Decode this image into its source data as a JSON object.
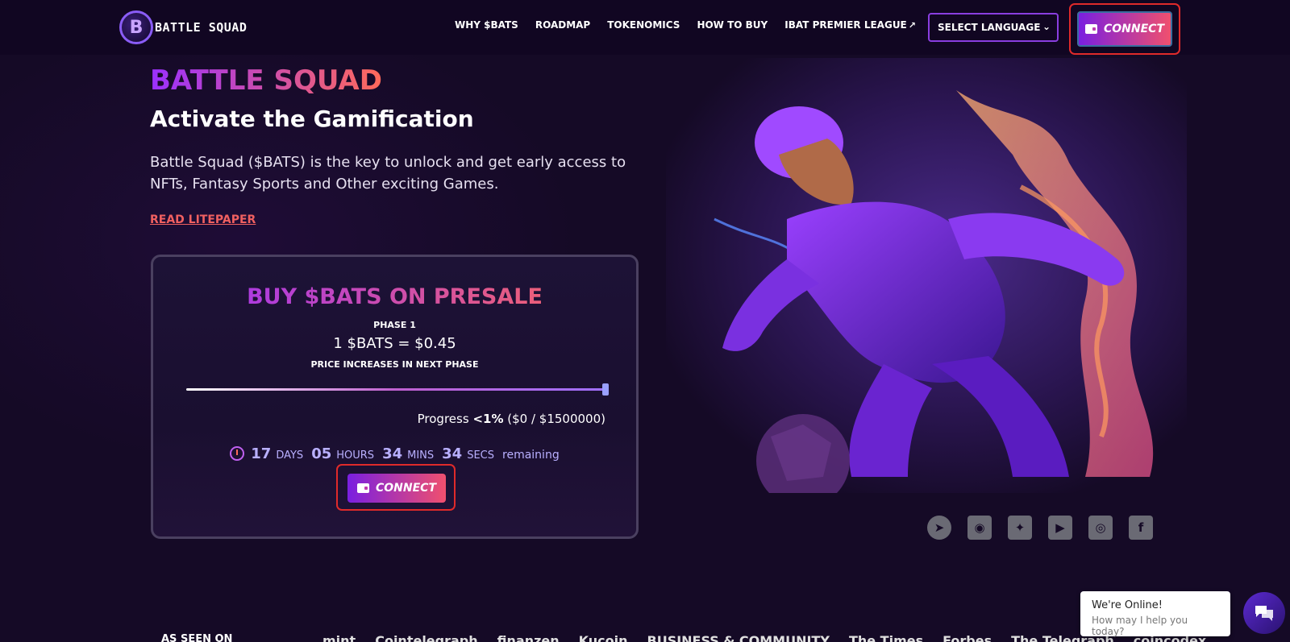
{
  "brand": {
    "logo_mark": "B",
    "name": "BATTLE SQUAD"
  },
  "nav": {
    "links": [
      "WHY $BATS",
      "ROADMAP",
      "TOKENOMICS",
      "HOW TO BUY",
      "IBAT PREMIER LEAGUE"
    ],
    "language_label": "SELECT LANGUAGE",
    "connect_label": "CONNECT"
  },
  "hero": {
    "title": "BATTLE SQUAD",
    "subtitle": "Activate the Gamification",
    "description": "Battle Squad ($BATS) is the key to unlock and get early access to NFTs, Fantasy Sports and Other exciting Games.",
    "litepaper_link": "READ LITEPAPER"
  },
  "presale": {
    "title": "BUY $BATS ON PRESALE",
    "phase": "PHASE 1",
    "price": "1 $BATS = $0.45",
    "note": "PRICE INCREASES IN NEXT PHASE",
    "progress_label": "Progress",
    "progress_value": "<1%",
    "progress_amount": "($0 / $1500000)",
    "progress_fraction": 1.0,
    "countdown": {
      "days": "17",
      "days_unit": "DAYS",
      "hours": "05",
      "hours_unit": "HOURS",
      "mins": "34",
      "mins_unit": "MINS",
      "secs": "34",
      "secs_unit": "SECS",
      "suffix": "remaining"
    },
    "connect_label": "CONNECT"
  },
  "social": {
    "telegram": "➤",
    "discord": "◉",
    "twitter": "✦",
    "youtube": "▶",
    "instagram": "◎",
    "facebook": "f"
  },
  "seen_on": {
    "label": "AS SEEN ON",
    "logos": [
      "mint",
      "Cointelegraph",
      "finanzen",
      "Kucoin",
      "BUSINESS & COMMUNITY",
      "The Times",
      "Forbes",
      "The Telegraph",
      "coincodex"
    ]
  },
  "chat": {
    "title": "We're Online!",
    "subtitle": "How may I help you today?"
  },
  "colors": {
    "background": "#150a26",
    "accent_gradient_start": "#7a1fe0",
    "accent_gradient_end": "#f0506e",
    "highlight_border": "#e02a2a"
  }
}
